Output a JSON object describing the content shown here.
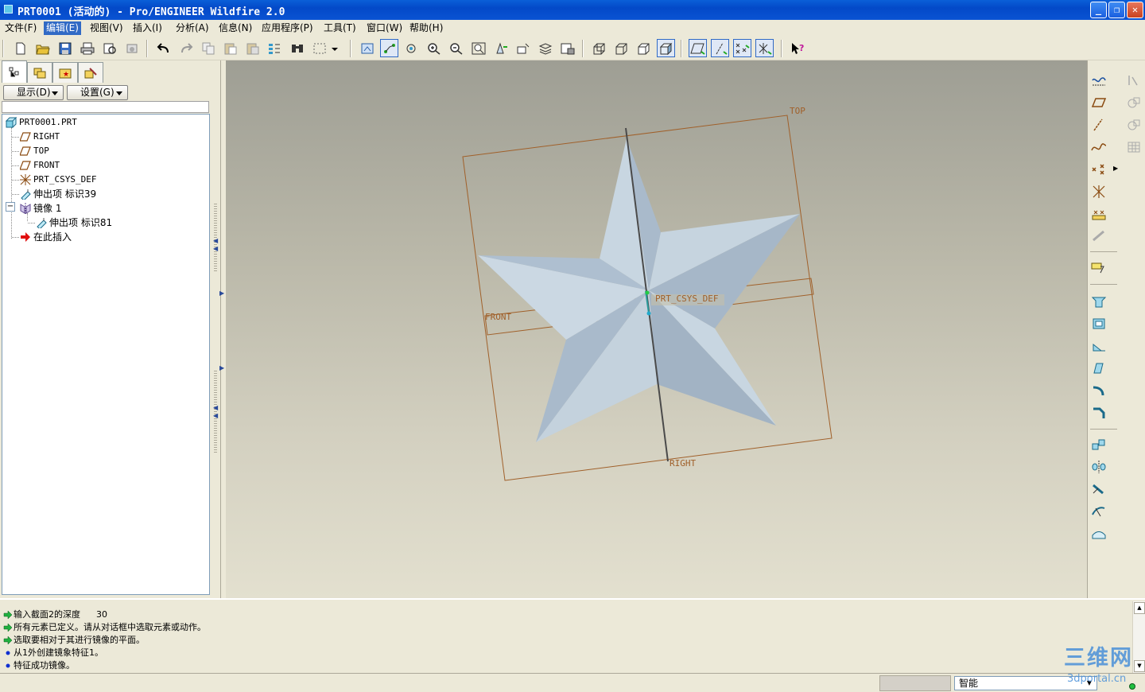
{
  "window": {
    "title": "PRT0001 (活动的) - Pro/ENGINEER Wildfire 2.0",
    "controls": [
      "_",
      "❐",
      "✕"
    ]
  },
  "menu": [
    {
      "label": "文件(F)"
    },
    {
      "label": "编辑(E)",
      "active": true
    },
    {
      "label": "视图(V)"
    },
    {
      "label": "插入(I)"
    },
    {
      "label": "分析(A)"
    },
    {
      "label": "信息(N)"
    },
    {
      "label": "应用程序(P)"
    },
    {
      "label": "工具(T)"
    },
    {
      "label": "窗口(W)"
    },
    {
      "label": "帮助(H)"
    }
  ],
  "toolbar_icons": [
    "new-file",
    "open-folder",
    "save",
    "print",
    "print-preview",
    "email",
    "undo",
    "redo",
    "copy",
    "paste",
    "paste-special",
    "regenerate",
    "find",
    "select-box",
    "dropdown",
    "repaint",
    "datum-display",
    "orient",
    "zoom-in",
    "zoom-out",
    "refit",
    "spin-center",
    "view-manager",
    "layers",
    "model-tree-settings",
    "wireframe",
    "hidden-line",
    "no-hidden",
    "shading",
    "datum-planes",
    "datum-axes",
    "datum-points",
    "coord-sys",
    "context-help"
  ],
  "nav_panel": {
    "display_label": "显示(D)",
    "settings_label": "设置(G)",
    "tree": [
      {
        "label": "PRT0001.PRT",
        "icon": "part-icon",
        "mono": true
      },
      {
        "label": "RIGHT",
        "icon": "datum-plane-icon",
        "mono": true
      },
      {
        "label": "TOP",
        "icon": "datum-plane-icon",
        "mono": true
      },
      {
        "label": "FRONT",
        "icon": "datum-plane-icon",
        "mono": true
      },
      {
        "label": "PRT_CSYS_DEF",
        "icon": "coord-system-icon",
        "mono": true
      },
      {
        "label": "伸出项 标识39",
        "icon": "extrude-icon"
      },
      {
        "label": "镜像 1",
        "icon": "mirror-icon"
      },
      {
        "label": "伸出项 标识81",
        "icon": "extrude-icon"
      },
      {
        "label": "在此插入",
        "icon": "insert-arrow-icon"
      }
    ]
  },
  "viewport": {
    "datum_labels": {
      "top": "TOP",
      "front": "FRONT",
      "right": "RIGHT",
      "csys": "PRT_CSYS_DEF"
    },
    "colors": {
      "datum": "#a0602a",
      "star_light": "#c5d3de",
      "star_dark": "#a4b6c5"
    }
  },
  "messages": [
    {
      "icon": "green-arrow",
      "text": "输入截面2的深度",
      "value": "30"
    },
    {
      "icon": "green-arrow",
      "text": "所有元素已定义。请从对话框中选取元素或动作。"
    },
    {
      "icon": "green-arrow",
      "text": "选取要相对于其进行镜像的平面。"
    },
    {
      "icon": "blue-dot",
      "text": "从1外创建镜象特征1。"
    },
    {
      "icon": "blue-dot",
      "text": "特征成功镜像。"
    }
  ],
  "status": {
    "filter_value": "智能"
  },
  "watermark": {
    "text": "三维网",
    "url": "3dportal.cn"
  }
}
